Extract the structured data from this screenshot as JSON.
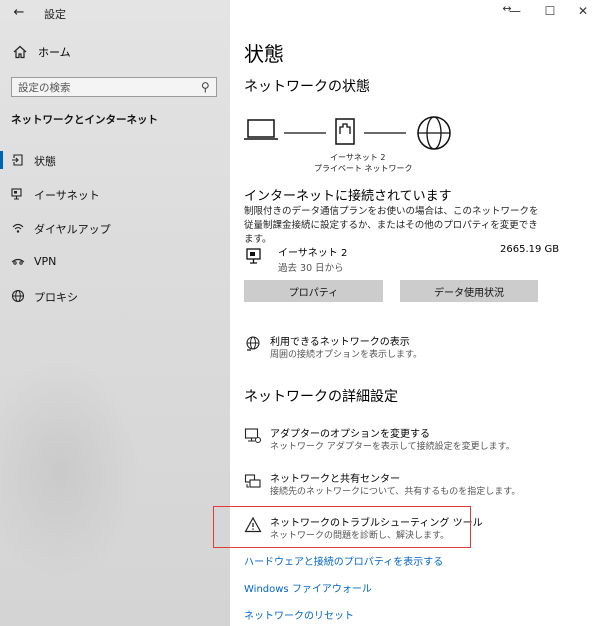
{
  "window": {
    "title": "設定",
    "controls": {
      "resize": "↔",
      "minimize": "—",
      "maximize": "☐",
      "close": "✕"
    }
  },
  "sidebar": {
    "home_label": "ホーム",
    "search_placeholder": "設定の検索",
    "section_title": "ネットワークとインターネット",
    "items": [
      {
        "label": "状態",
        "icon": "status-icon",
        "selected": true
      },
      {
        "label": "イーサネット",
        "icon": "ethernet-icon",
        "selected": false
      },
      {
        "label": "ダイヤルアップ",
        "icon": "dialup-icon",
        "selected": false
      },
      {
        "label": "VPN",
        "icon": "vpn-icon",
        "selected": false
      },
      {
        "label": "プロキシ",
        "icon": "proxy-icon",
        "selected": false
      }
    ]
  },
  "main": {
    "page_title": "状態",
    "network_status_heading": "ネットワークの状態",
    "diagram": {
      "adapter_label": "イーサネット 2",
      "network_label": "プライベート ネットワーク"
    },
    "connection_title": "インターネットに接続されています",
    "connection_desc": "制限付きのデータ通信プランをお使いの場合は、このネットワークを従量制課金接続に設定するか、またはその他のプロパティを変更できます。",
    "adapter": {
      "name": "イーサネット 2",
      "period": "過去 30 日から",
      "usage": "2665.19 GB"
    },
    "buttons": {
      "properties": "プロパティ",
      "data_usage": "データ使用状況"
    },
    "show_networks": {
      "title": "利用できるネットワークの表示",
      "desc": "周囲の接続オプションを表示します。"
    },
    "advanced_heading": "ネットワークの詳細設定",
    "advanced_items": [
      {
        "title": "アダプターのオプションを変更する",
        "desc": "ネットワーク アダプターを表示して接続設定を変更します。",
        "icon": "adapter-options-icon"
      },
      {
        "title": "ネットワークと共有センター",
        "desc": "接続先のネットワークについて、共有するものを指定します。",
        "icon": "sharing-center-icon"
      },
      {
        "title": "ネットワークのトラブルシューティング ツール",
        "desc": "ネットワークの問題を診断し、解決します。",
        "icon": "warning-icon"
      }
    ],
    "links": {
      "hardware": "ハードウェアと接続のプロパティを表示する",
      "firewall": "Windows ファイアウォール",
      "reset": "ネットワークのリセット"
    }
  },
  "colors": {
    "accent": "#0063b1",
    "link": "#0066cc",
    "highlight": "#e23b3b",
    "button": "#cccccc"
  }
}
